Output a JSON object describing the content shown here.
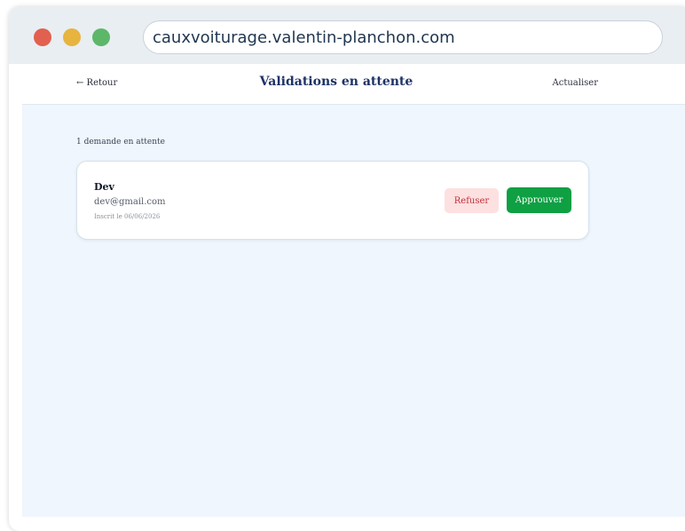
{
  "browser": {
    "url": "cauxvoiturage.valentin-planchon.com"
  },
  "header": {
    "back_label": "← Retour",
    "title": "Validations en attente",
    "refresh_label": "Actualiser"
  },
  "main": {
    "pending_count_text": "1 demande en attente",
    "requests": [
      {
        "name": "Dev",
        "email": "dev@gmail.com",
        "registered": "Inscrit le 06/06/2026",
        "reject_label": "Refuser",
        "approve_label": "Approuver"
      }
    ]
  },
  "colors": {
    "title": "#1e3266",
    "approve": "#0ea043",
    "reject_bg": "#fde0e0",
    "reject_text": "#c0323a",
    "page_bg": "#eff6fd"
  }
}
